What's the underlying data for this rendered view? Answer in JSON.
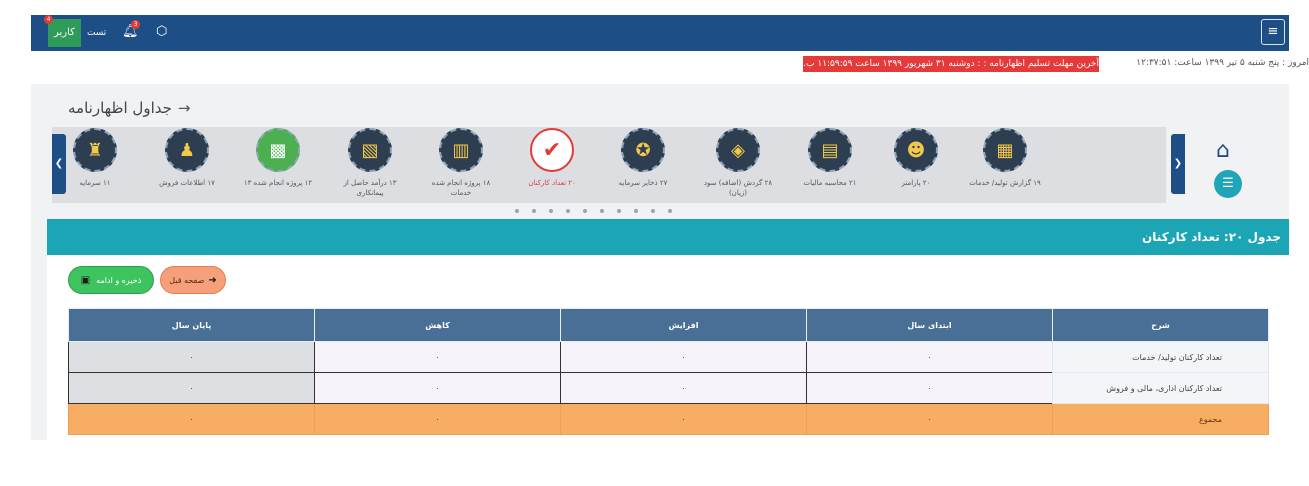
{
  "topbar": {
    "user_name": "تست",
    "user_role": "کاربر",
    "user_badge": "4",
    "bell_badge": "3"
  },
  "info": {
    "deadline_text": "آخرین مهلت تسلیم اظهارنامه : : دوشنبه ۳۱ شهریور ۱۳۹۹ ساعت ۱۱:۵۹:۵۹ ب.ظ",
    "datetime_text": "امروز : پنج شنبه ۵ تیر ۱۳۹۹ ساعت: ۱۲:۳۷:۵۱"
  },
  "page": {
    "heading": "جداول اظهارنامه"
  },
  "steps": [
    {
      "label": "۱۹ گزارش تولید/ خدمات",
      "icon": "factory-icon",
      "glyph": "▦"
    },
    {
      "label": "۲۰ پارامتر",
      "icon": "worker-icon",
      "glyph": "☻"
    },
    {
      "label": "۲۱ محاسبه مالیات",
      "icon": "calculator-icon",
      "glyph": "▤"
    },
    {
      "label": "۲۸ گردش (اضافه) سود (زیان)",
      "icon": "money-icon",
      "glyph": "◈"
    },
    {
      "label": "۲۷ ذخایر سرمایه",
      "icon": "coins-icon",
      "glyph": "✪"
    },
    {
      "label": "۲۰ تعداد کارکنان",
      "icon": "check-icon",
      "glyph": "✔"
    },
    {
      "label": "۱۸ پروژه انجام شده خدمات",
      "icon": "buildings-icon",
      "glyph": "▥"
    },
    {
      "label": "۱۳ درآمد حاصل از پیمانکاری",
      "icon": "document-icon",
      "glyph": "▧"
    },
    {
      "label": "۱۲ پروژه انجام شده ۱۳",
      "icon": "calculator-green-icon",
      "glyph": "▩"
    },
    {
      "label": "۱۷ اطلاعات فروش",
      "icon": "chart-icon",
      "glyph": "♟"
    },
    {
      "label": "۱۱ سرمایه",
      "icon": "money-bag-icon",
      "glyph": "♜"
    }
  ],
  "table_title": "جدول ۲۰: تعداد کارکنان",
  "buttons": {
    "prev_label": "صفحه قبل",
    "save_label": "ذخیره و ادامه"
  },
  "table": {
    "headers": [
      "شرح",
      "ابتدای سال",
      "افزایش",
      "کاهش",
      "پایان سال"
    ],
    "rows": [
      {
        "desc": "تعداد کارکنان تولید/ خدمات",
        "values": [
          "۰",
          "۰",
          "۰",
          "۰"
        ]
      },
      {
        "desc": "تعداد کارکنان اداری، مالی و فروش",
        "values": [
          "۰",
          "۰",
          "۰",
          "۰"
        ]
      }
    ],
    "total": {
      "desc": "مجموع",
      "values": [
        "۰",
        "۰",
        "۰",
        "۰"
      ]
    }
  }
}
